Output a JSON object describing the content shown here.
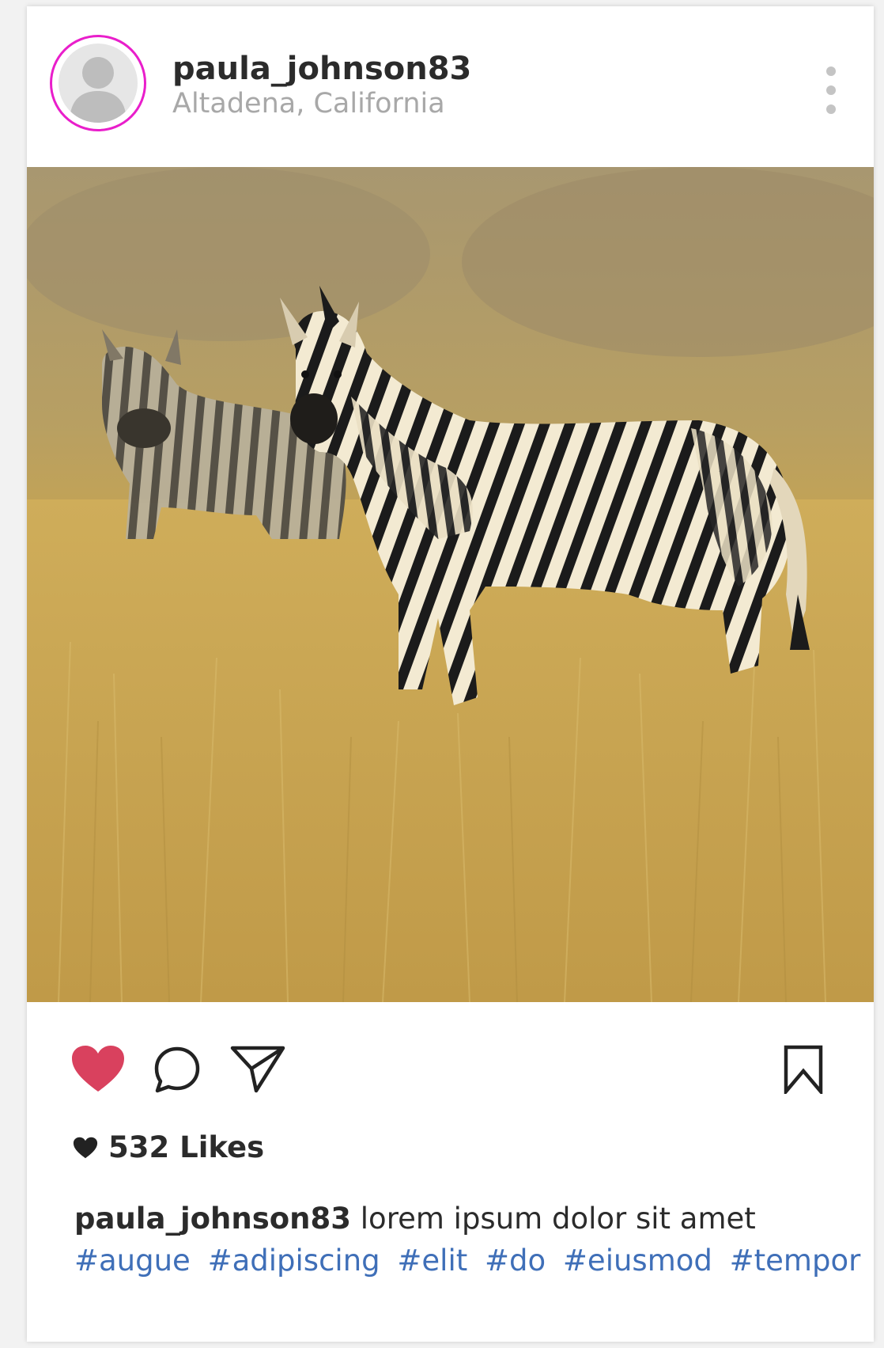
{
  "post": {
    "username": "paula_johnson83",
    "location": "Altadena, California",
    "likes_text": "532 Likes",
    "caption_user": "paula_johnson83",
    "caption_text": "lorem ipsum dolor sit amet",
    "hashtags": [
      "#augue",
      "#adipiscing",
      "#elit",
      "#do",
      "#eiusmod",
      "#tempor"
    ],
    "liked": true
  },
  "icons": {
    "menu": "more-vertical-icon",
    "like": "heart-icon",
    "comment": "comment-icon",
    "share": "send-icon",
    "save": "bookmark-icon",
    "likes_prefix": "heart-small-icon"
  },
  "colors": {
    "avatar_ring": "#e91ecb",
    "like_active": "#d9415e",
    "hashtag": "#3f6fb8",
    "location": "#a8a8a8",
    "text": "#2b2b2b"
  }
}
